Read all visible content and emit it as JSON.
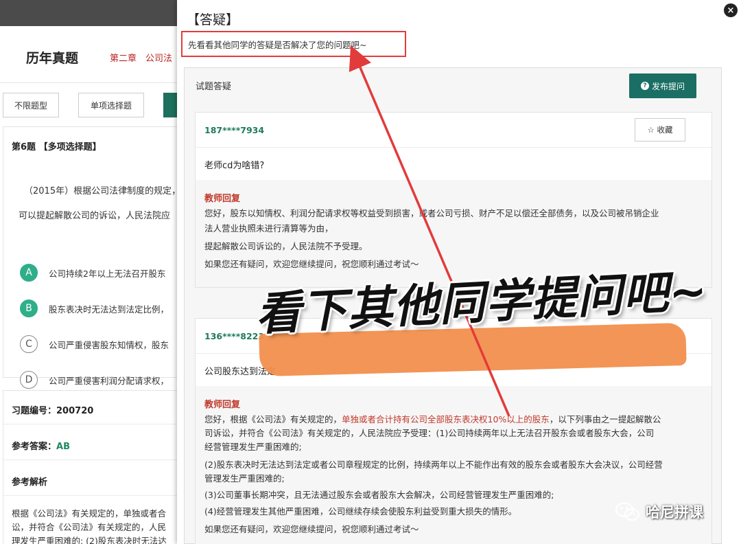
{
  "background": {
    "page_title": "历年真题",
    "chapter": "第二章　公司法",
    "tabs": [
      "不限题型",
      "单项选择题"
    ],
    "question_label": "第6题 【多项选择题】",
    "question_text_1": "（2015年）根据公司法律制度的规定，",
    "question_text_2": "可以提起解散公司的诉讼，人民法院应",
    "options": [
      {
        "letter": "A",
        "text": "公司持续2年以上无法召开股东"
      },
      {
        "letter": "B",
        "text": "股东表决时无法达到法定比例，"
      },
      {
        "letter": "C",
        "text": "公司严重侵害股东知情权，股东"
      },
      {
        "letter": "D",
        "text": "公司严重侵害利润分配请求权，"
      }
    ],
    "exercise_id_label": "习题编号：",
    "exercise_id": "200720",
    "answer_label": "参考答案：",
    "answer": "AB",
    "analysis_label": "参考解析",
    "analysis_lines": [
      "根据《公司法》有关规定的，单独或者合",
      "讼，并符合《公司法》有关规定的，人民",
      "理发生严重困难的; (2)股东表决时无法达"
    ]
  },
  "modal": {
    "title": "【答疑】",
    "close": "×",
    "hint": "先看看其他同学的答疑是否解决了您的问题吧~",
    "panel_title": "试题答疑",
    "ask_button": "发布提问",
    "qa": [
      {
        "user": "187****7934",
        "favorite": "☆ 收藏",
        "question": "老师cd为啥错?",
        "reply_label": "教师回复",
        "reply_lines": [
          "您好，股东以知情权、利润分配请求权等权益受到损害，或者公司亏损、财产不足以偿还全部债务，以及公司被吊销企业",
          "法人营业执照未进行清算等为由，",
          "提起解散公司诉讼的，人民法院不予受理。",
          "如果您还有疑问，欢迎您继续提问，祝您顺利通过考试～"
        ]
      },
      {
        "user": "136****8223",
        "question": "公司股东达到法定",
        "reply_label": "教师回复",
        "reply_line1_pre": "您好，根据《公司法》有关规定的，",
        "reply_line1_red": "单独或者合计持有公司全部股东表决权10%以上的股东",
        "reply_line1_post": "，以下列事由之一提起解散公",
        "reply_lines": [
          "司诉讼，并符合《公司法》有关规定的，人民法院应予受理：(1)公司持续两年以上无法召开股东会或者股东大会，公司",
          "经营管理发生严重困难的;",
          "(2)股东表决时无法达到法定或者公司章程规定的比例，持续两年以上不能作出有效的股东会或者股东大会决议，公司经营",
          "管理发生严重困难的;",
          "(3)公司董事长期冲突，且无法通过股东会或者股东大会解决，公司经营管理发生严重困难的;",
          "(4)经营管理发生其他严重困难，公司继续存续会使股东利益受到重大损失的情形。",
          "如果您还有疑问，欢迎您继续提问，祝您顺利通过考试～"
        ]
      }
    ]
  },
  "overlay": {
    "banner": "看下其他同学提问吧~",
    "watermark": "哈尼拼课",
    "arrow_color": "#e23b3b",
    "highlight_color": "#f28f4d"
  }
}
